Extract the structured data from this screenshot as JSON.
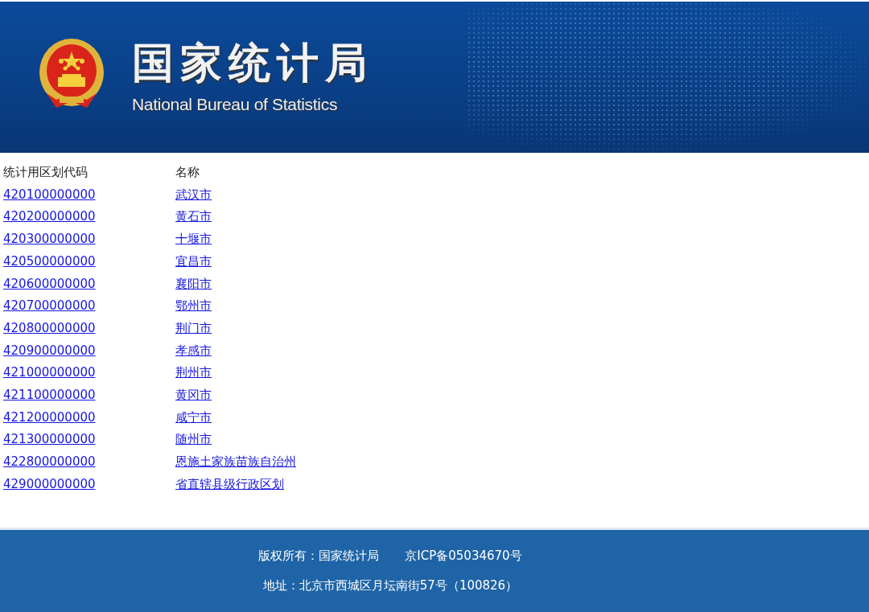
{
  "header": {
    "title": "国家统计局",
    "subtitle": "National Bureau of Statistics"
  },
  "table": {
    "columns": [
      "统计用区划代码",
      "名称"
    ],
    "rows": [
      {
        "code": "420100000000",
        "name": "武汉市"
      },
      {
        "code": "420200000000",
        "name": "黄石市"
      },
      {
        "code": "420300000000",
        "name": "十堰市"
      },
      {
        "code": "420500000000",
        "name": "宜昌市"
      },
      {
        "code": "420600000000",
        "name": "襄阳市"
      },
      {
        "code": "420700000000",
        "name": "鄂州市"
      },
      {
        "code": "420800000000",
        "name": "荆门市"
      },
      {
        "code": "420900000000",
        "name": "孝感市"
      },
      {
        "code": "421000000000",
        "name": "荆州市"
      },
      {
        "code": "421100000000",
        "name": "黄冈市"
      },
      {
        "code": "421200000000",
        "name": "咸宁市"
      },
      {
        "code": "421300000000",
        "name": "随州市"
      },
      {
        "code": "422800000000",
        "name": "恩施土家族苗族自治州"
      },
      {
        "code": "429000000000",
        "name": "省直辖县级行政区划"
      }
    ]
  },
  "footer": {
    "copyright": "版权所有：国家统计局",
    "icp": "京ICP备05034670号",
    "address": "地址：北京市西城区月坛南街57号（100826）"
  }
}
